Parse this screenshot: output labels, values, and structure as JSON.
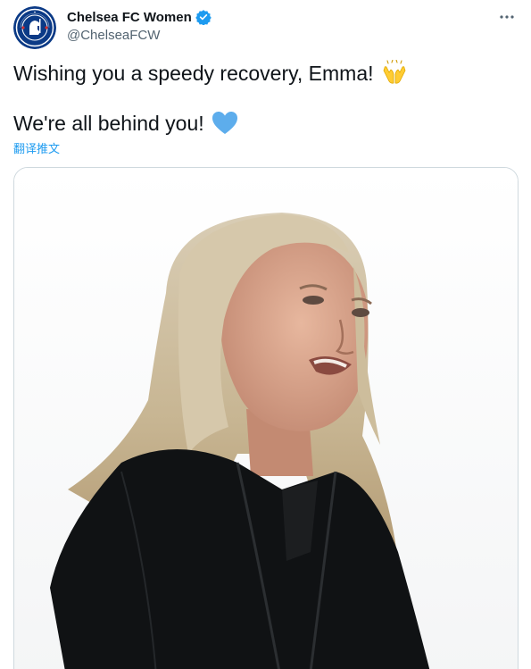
{
  "author": {
    "display_name": "Chelsea FC Women",
    "handle": "@ChelseaFCW",
    "verified": true,
    "avatar_icon": "chelsea-crest-icon",
    "brand_color": "#034694"
  },
  "tweet": {
    "line1": "Wishing you a speedy recovery, Emma!",
    "line1_emoji": "raising-hands-icon",
    "line2": "We're all behind you!",
    "line2_emoji": "blue-heart-icon",
    "translate_label": "翻译推文"
  },
  "media": {
    "type": "photo",
    "description_icon": "photo-woman-blonde-black-jacket"
  },
  "colors": {
    "link": "#1d9bf0",
    "secondary_text": "#536471",
    "border": "#cfd9de",
    "verified": "#1d9bf0",
    "heart": "#5dadec"
  }
}
